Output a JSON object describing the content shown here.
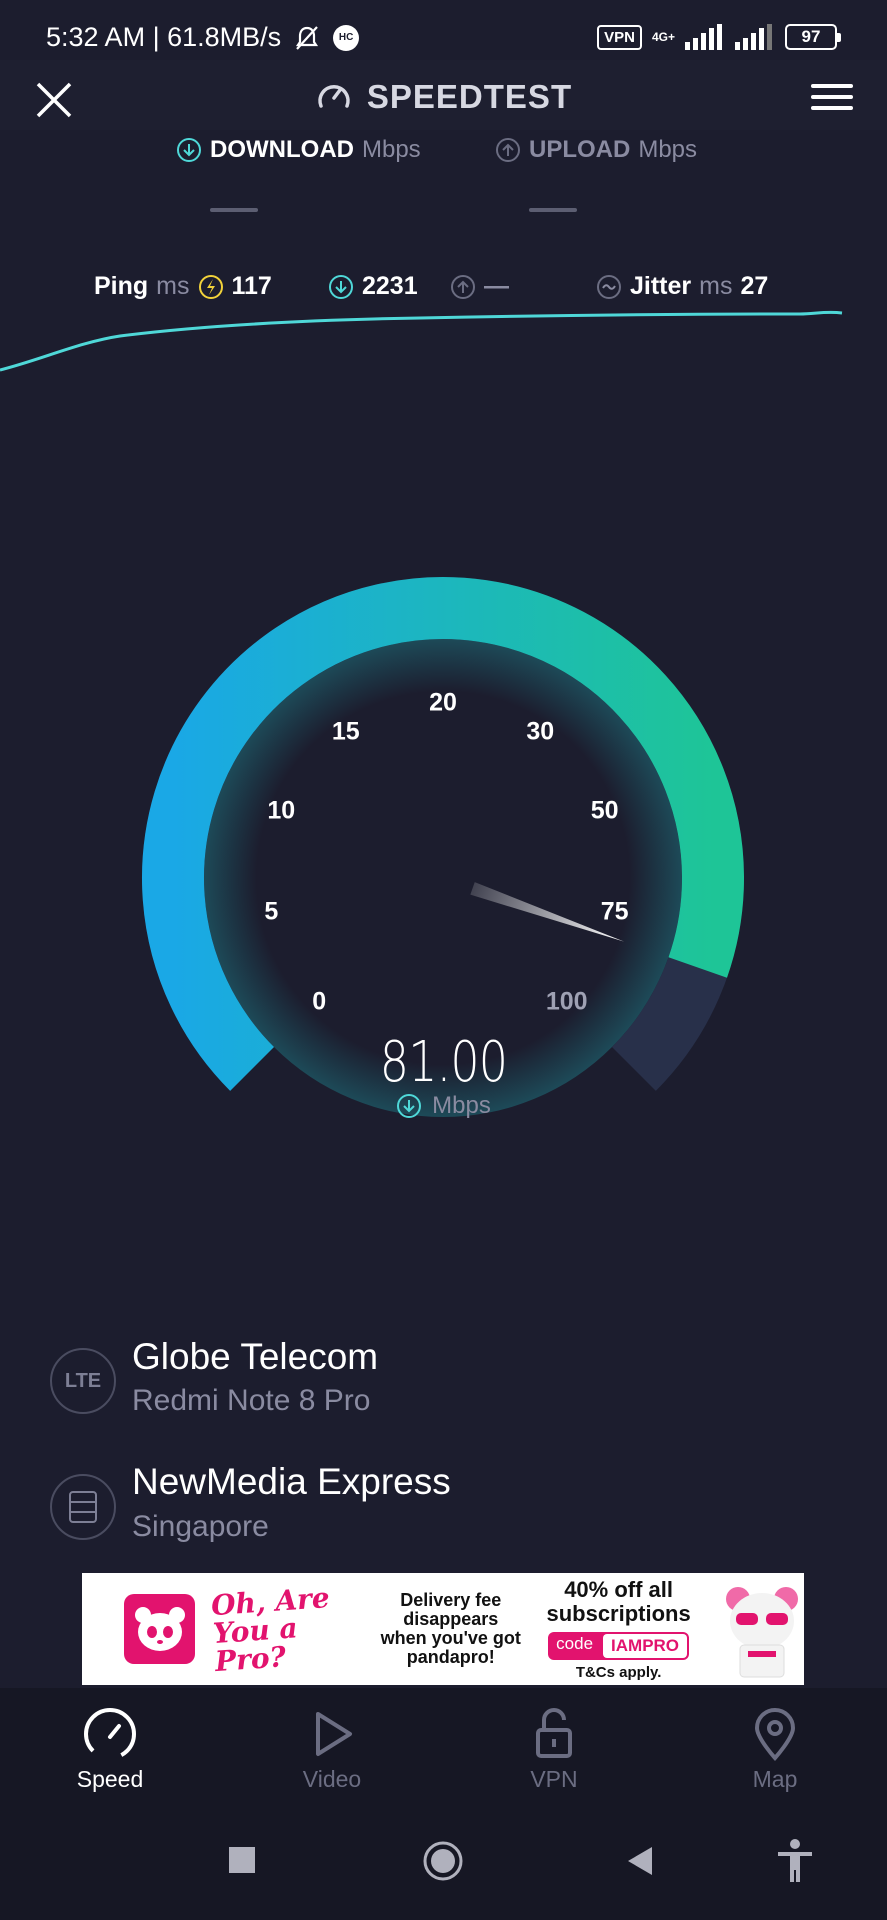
{
  "status_bar": {
    "time_speed": "5:32 AM | 61.8MB/s",
    "hc_badge": "HC",
    "vpn": "VPN",
    "network_type": "4G+",
    "battery": "97"
  },
  "header": {
    "title": "SPEEDTEST",
    "icons": {
      "close": "close-icon",
      "menu": "hamburger-menu-icon",
      "logo": "speedometer-icon"
    }
  },
  "tabs": {
    "download": {
      "label": "DOWNLOAD",
      "unit": "Mbps",
      "value": "—"
    },
    "upload": {
      "label": "UPLOAD",
      "unit": "Mbps",
      "value": "—"
    }
  },
  "ping_row": {
    "ping_label": "Ping",
    "ping_unit": "ms",
    "idle_ping": "117",
    "download_ping": "2231",
    "upload_ping": "—",
    "jitter_label": "Jitter",
    "jitter_unit": "ms",
    "jitter_value": "27"
  },
  "gauge": {
    "scale": [
      "0",
      "5",
      "10",
      "15",
      "20",
      "30",
      "50",
      "75",
      "100"
    ],
    "current_value": 81.0,
    "display_value": "81.00",
    "unit": "Mbps",
    "colors": {
      "start": "#1aa8e6",
      "end": "#1ec597",
      "track": "#28304a",
      "background": "#1c1d2e"
    }
  },
  "provider": {
    "badge": "LTE",
    "name": "Globe Telecom",
    "device": "Redmi Note 8 Pro"
  },
  "server": {
    "icon": "server-icon",
    "name": "NewMedia Express",
    "location": "Singapore"
  },
  "ad": {
    "headline": "Oh, Are You a Pro?",
    "middle": [
      "Delivery fee",
      "disappears",
      "when you've got",
      "pandapro!"
    ],
    "offer": "40% off all subscriptions",
    "code_label": "code",
    "code_value": "IAMPRO",
    "terms": "T&Cs apply.",
    "brand_color": "#e2136e"
  },
  "bottom_nav": {
    "items": [
      {
        "label": "Speed",
        "icon": "speedometer-icon",
        "active": true
      },
      {
        "label": "Video",
        "icon": "play-icon",
        "active": false
      },
      {
        "label": "VPN",
        "icon": "unlock-icon",
        "active": false
      },
      {
        "label": "Map",
        "icon": "map-pin-icon",
        "active": false
      }
    ]
  },
  "system_nav": {
    "icons": [
      "recents-square-icon",
      "home-circle-icon",
      "back-triangle-icon",
      "accessibility-icon"
    ]
  },
  "accent_color": "#4fd8d8"
}
